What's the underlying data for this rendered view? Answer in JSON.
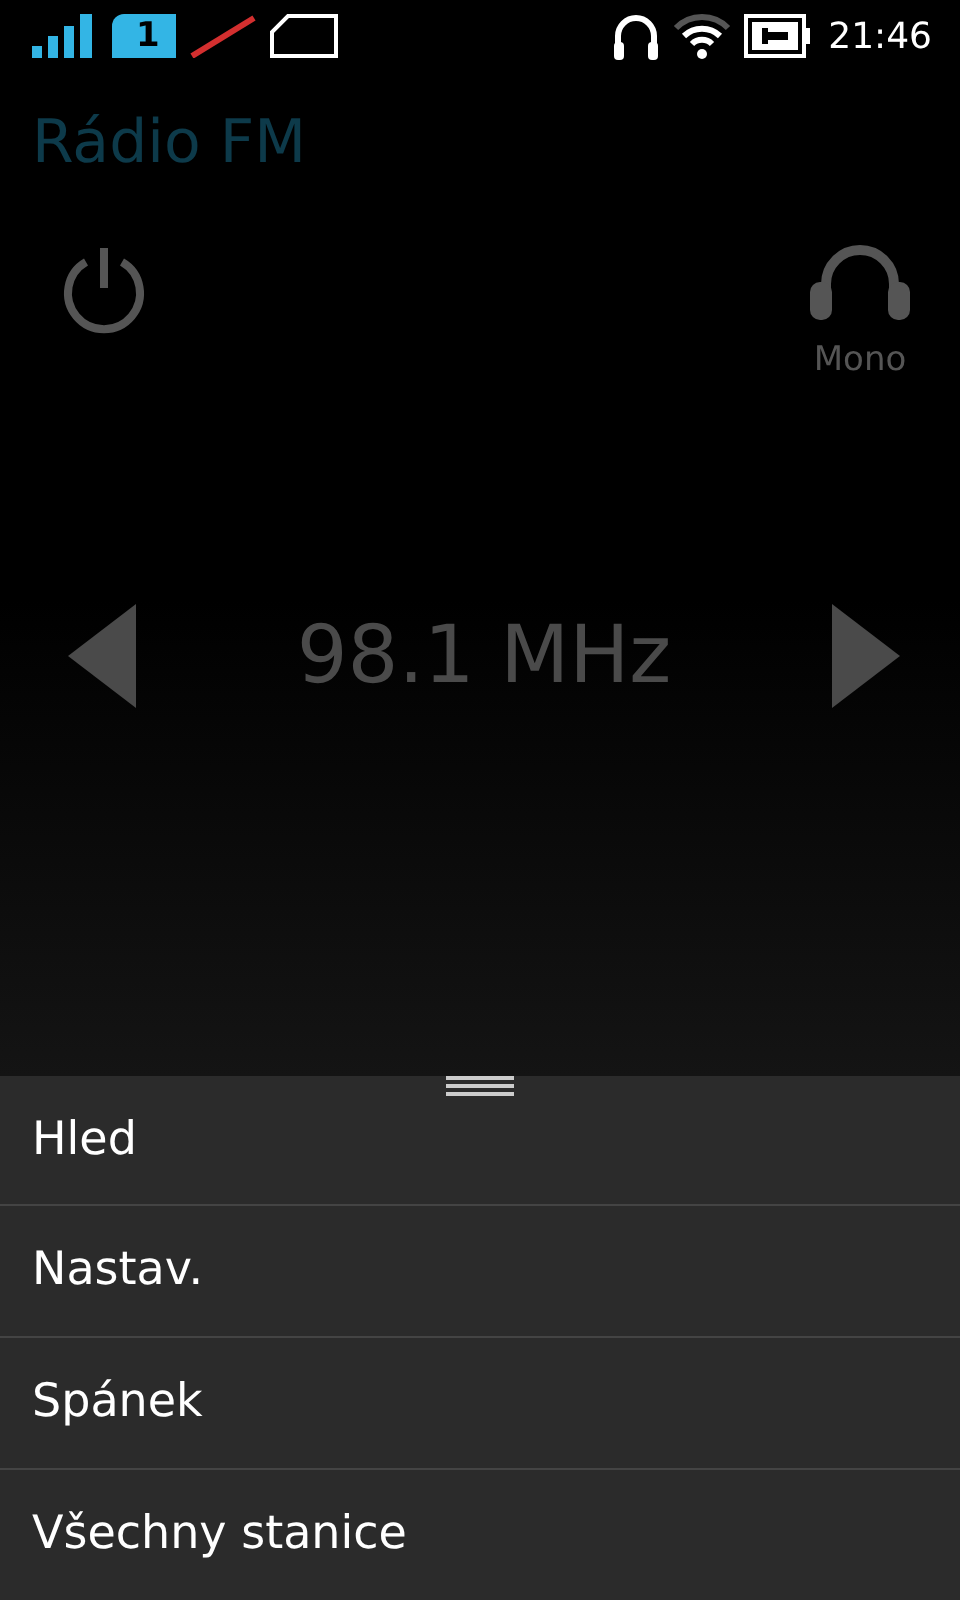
{
  "status_bar": {
    "sim_number": "1",
    "time": "21:46"
  },
  "title": "Rádio FM",
  "audio_mode": "Mono",
  "frequency": "98.1 MHz",
  "menu": [
    {
      "label": "Hled"
    },
    {
      "label": "Nastav."
    },
    {
      "label": "Spánek"
    },
    {
      "label": "Všechny stanice"
    }
  ]
}
